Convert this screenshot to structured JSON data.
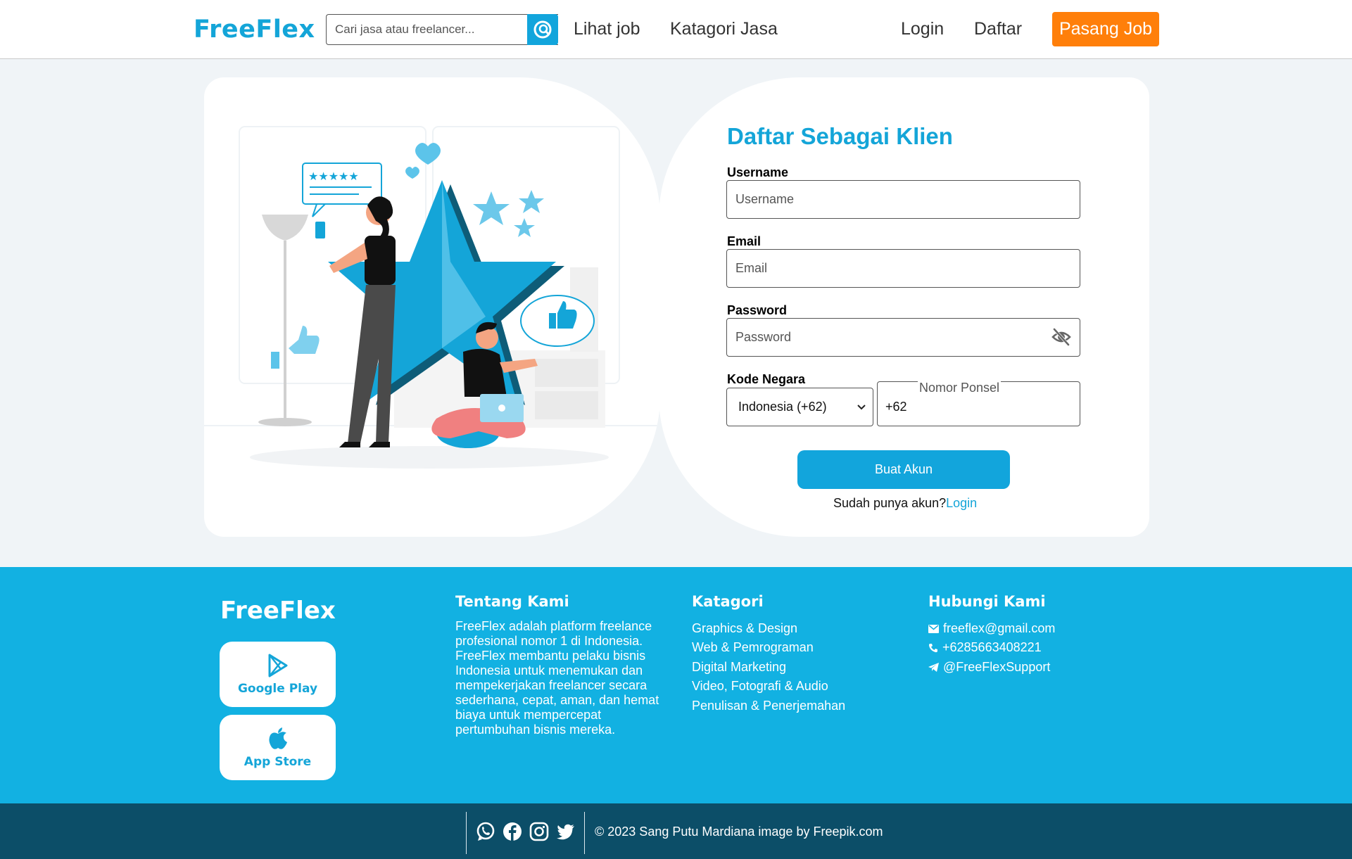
{
  "colors": {
    "brand": "#14a5d8",
    "accent": "#ff7f0a",
    "footer": "#12b1e2",
    "bottom_bar": "#0c4e68"
  },
  "header": {
    "logo": "FreeFlex",
    "search_placeholder": "Cari jasa atau freelancer...",
    "search_icon": "search-icon",
    "nav": {
      "browse_jobs": "Lihat job",
      "categories": "Katagori Jasa",
      "login": "Login",
      "register": "Daftar"
    },
    "post_job": "Pasang Job"
  },
  "illustration": {
    "description_icon": "star-review-illustration"
  },
  "form": {
    "title": "Daftar Sebagai Klien",
    "username": {
      "label": "Username",
      "placeholder": "Username"
    },
    "email": {
      "label": "Email",
      "placeholder": "Email"
    },
    "password": {
      "label": "Password",
      "placeholder": "Password",
      "toggle_icon": "eye-off-icon"
    },
    "country": {
      "label": "Kode Negara",
      "selected": "Indonesia (+62)"
    },
    "phone": {
      "legend": "Nomor Ponsel",
      "value": "+62"
    },
    "submit": "Buat Akun",
    "login_prompt": "Sudah punya akun?",
    "login_link": "Login"
  },
  "footer": {
    "logo": "FreeFlex",
    "stores": [
      {
        "label": "Google Play",
        "icon": "google-play-icon"
      },
      {
        "label": "App Store",
        "icon": "apple-icon"
      }
    ],
    "about": {
      "heading": "Tentang Kami",
      "text": "FreeFlex adalah platform freelance profesional nomor 1 di Indonesia. FreeFlex membantu pelaku bisnis Indonesia untuk menemukan dan mempekerjakan freelancer secara sederhana, cepat, aman, dan hemat biaya untuk mempercepat pertumbuhan bisnis mereka."
    },
    "categories": {
      "heading": "Katagori",
      "items": [
        "Graphics & Design",
        "Web & Pemrograman",
        "Digital Marketing",
        "Video, Fotografi & Audio",
        "Penulisan & Penerjemahan"
      ]
    },
    "contact": {
      "heading": "Hubungi Kami",
      "email": "freeflex@gmail.com",
      "phone": "+6285663408221",
      "telegram": "@FreeFlexSupport"
    }
  },
  "bottom": {
    "socials": [
      "whatsapp-icon",
      "facebook-icon",
      "instagram-icon",
      "twitter-icon"
    ],
    "copyright": "© 2023 Sang Putu Mardiana image by Freepik.com"
  }
}
